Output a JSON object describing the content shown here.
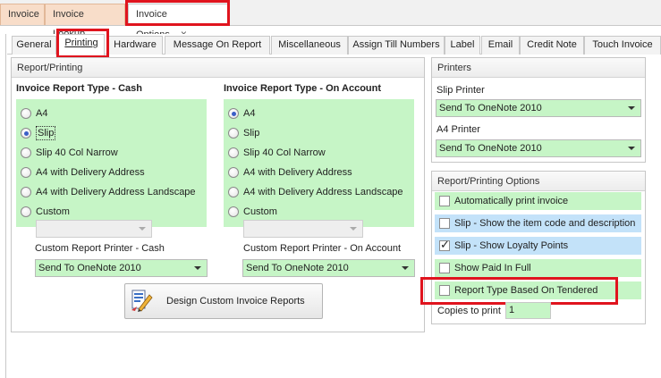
{
  "doc_tabs": [
    {
      "label": "Invoice"
    },
    {
      "label": "Invoice Lookup"
    },
    {
      "label": "Invoice Options",
      "close": "×"
    }
  ],
  "sub_tabs": [
    {
      "label": "General"
    },
    {
      "label": "Printing"
    },
    {
      "label": "Hardware"
    },
    {
      "label": "Message On Report"
    },
    {
      "label": "Miscellaneous"
    },
    {
      "label": "Assign Till Numbers"
    },
    {
      "label": "Label"
    },
    {
      "label": "Email"
    },
    {
      "label": "Credit Note"
    },
    {
      "label": "Touch Invoice"
    }
  ],
  "report_printing": {
    "title": "Report/Printing",
    "cash": {
      "heading": "Invoice Report Type - Cash",
      "options": [
        "A4",
        "Slip",
        "Slip 40 Col Narrow",
        "A4 with Delivery Address",
        "A4 with Delivery Address Landscape",
        "Custom"
      ],
      "selected": "Slip",
      "custom_dropdown_value": "",
      "printer_label": "Custom Report Printer - Cash",
      "printer_value": "Send To OneNote 2010"
    },
    "account": {
      "heading": "Invoice Report Type - On Account",
      "options": [
        "A4",
        "Slip",
        "Slip 40 Col Narrow",
        "A4 with Delivery Address",
        "A4 with Delivery Address Landscape",
        "Custom"
      ],
      "selected": "A4",
      "custom_dropdown_value": "",
      "printer_label": "Custom Report Printer - On Account",
      "printer_value": "Send To OneNote 2010"
    },
    "design_button": "Design Custom Invoice Reports"
  },
  "printers": {
    "title": "Printers",
    "slip_label": "Slip Printer",
    "slip_value": "Send To OneNote 2010",
    "a4_label": "A4 Printer",
    "a4_value": "Send To OneNote 2010"
  },
  "options": {
    "title": "Report/Printing Options",
    "items": [
      {
        "label": "Automatically print invoice",
        "checked": false,
        "color": "green"
      },
      {
        "label": "Slip - Show the item code and description",
        "checked": false,
        "color": "blue"
      },
      {
        "label": "Slip - Show Loyalty Points",
        "checked": true,
        "color": "blue"
      },
      {
        "label": "Show Paid In Full",
        "checked": false,
        "color": "green"
      },
      {
        "label": "Report Type Based On Tendered",
        "checked": false,
        "color": "green"
      }
    ],
    "copies_label": "Copies to print",
    "copies_value": "1"
  },
  "colors": {
    "highlight_green": "#c6f5c6",
    "highlight_blue": "#c3e2f9",
    "annotation_red": "#e0141e",
    "doc_tab_orange": "#f8ddc9"
  }
}
